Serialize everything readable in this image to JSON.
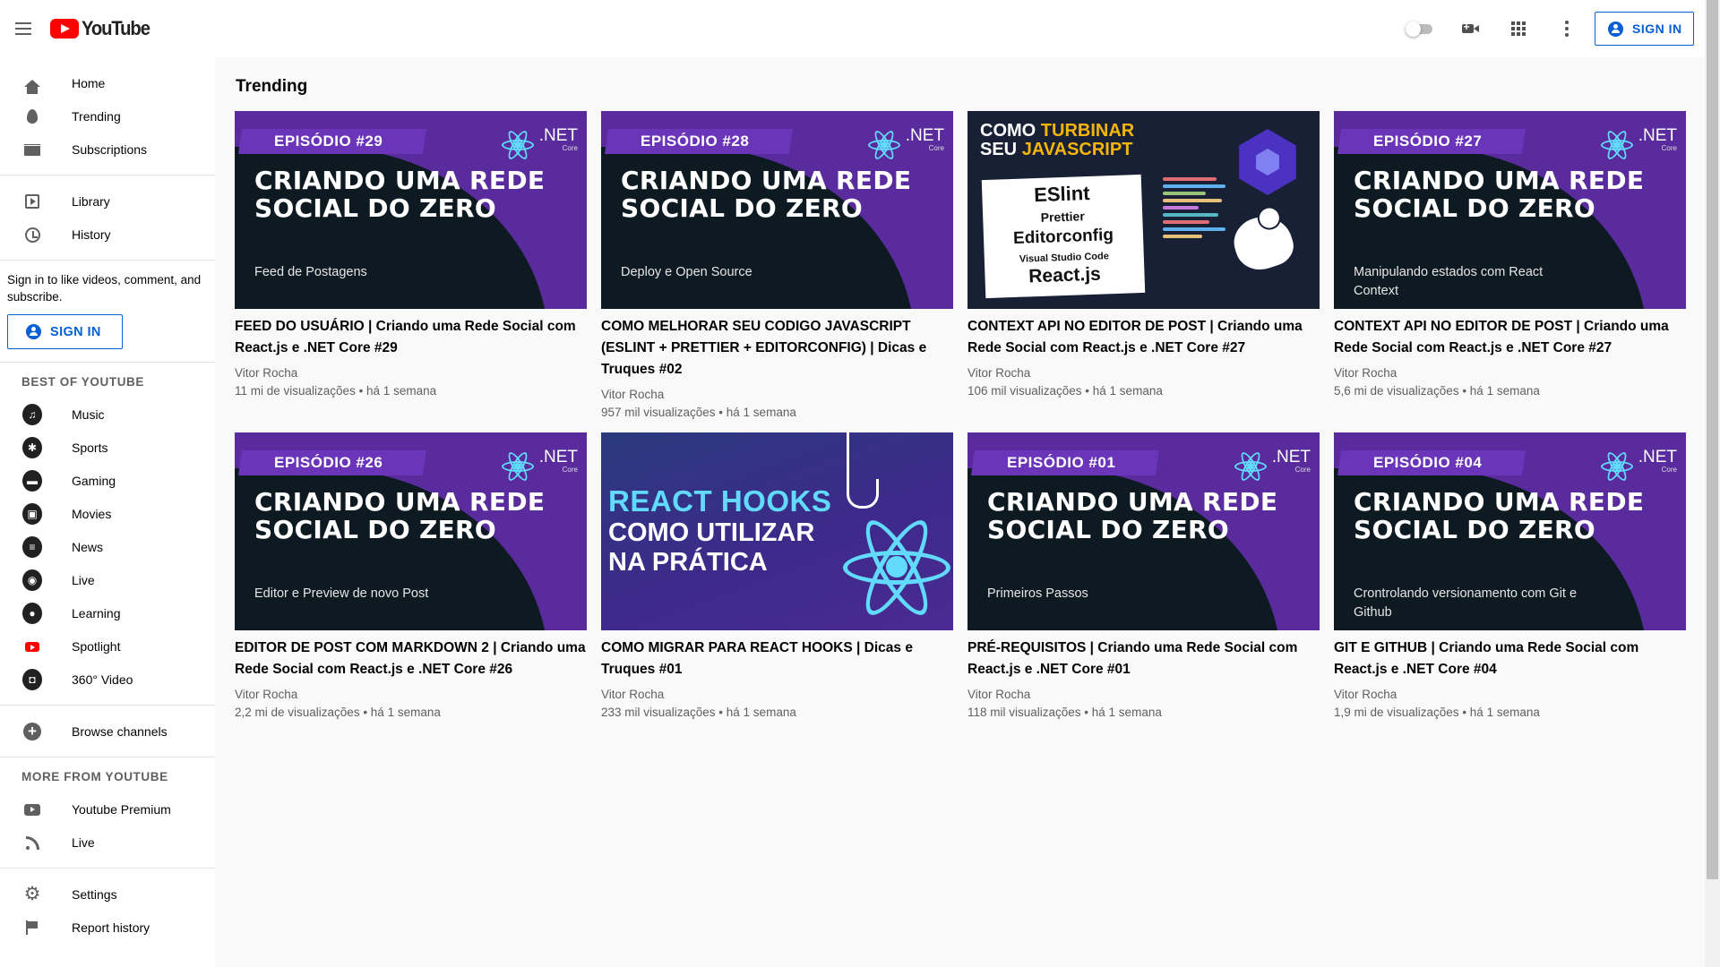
{
  "header": {
    "logo_text": "YouTube",
    "signin_label": "SIGN IN"
  },
  "sidebar": {
    "primary": [
      {
        "label": "Home",
        "icon": "home-icon"
      },
      {
        "label": "Trending",
        "icon": "trending-icon"
      },
      {
        "label": "Subscriptions",
        "icon": "subscriptions-icon"
      }
    ],
    "library": [
      {
        "label": "Library",
        "icon": "library-icon"
      },
      {
        "label": "History",
        "icon": "history-icon"
      }
    ],
    "signin_prompt": "Sign in to like videos, comment, and subscribe.",
    "signin_label": "SIGN IN",
    "best_title": "BEST OF YOUTUBE",
    "best": [
      {
        "label": "Music",
        "icon": "music-icon"
      },
      {
        "label": "Sports",
        "icon": "sports-icon"
      },
      {
        "label": "Gaming",
        "icon": "gaming-icon"
      },
      {
        "label": "Movies",
        "icon": "movies-icon"
      },
      {
        "label": "News",
        "icon": "news-icon"
      },
      {
        "label": "Live",
        "icon": "live-icon"
      },
      {
        "label": "Learning",
        "icon": "learning-icon"
      },
      {
        "label": "Spotlight",
        "icon": "spotlight-icon"
      },
      {
        "label": "360° Video",
        "icon": "360-video-icon"
      }
    ],
    "browse_label": "Browse channels",
    "more_title": "MORE FROM YOUTUBE",
    "more": [
      {
        "label": "Youtube Premium",
        "icon": "youtube-premium-icon"
      },
      {
        "label": "Live",
        "icon": "live-feed-icon"
      }
    ],
    "settings": [
      {
        "label": "Settings",
        "icon": "settings-icon"
      },
      {
        "label": "Report history",
        "icon": "report-flag-icon"
      }
    ]
  },
  "main": {
    "title": "Trending",
    "videos": [
      {
        "title": "FEED DO USUÁRIO | Criando uma Rede Social com React.js e .NET Core #29",
        "channel": "Vitor Rocha",
        "meta": "11 mi de visualizações • há 1 semana",
        "thumb": {
          "episode": "EPISÓDIO #29",
          "headline": "CRIANDO UMA REDE SOCIAL DO ZERO",
          "subtitle": "Feed de Postagens",
          "net": ".NET",
          "core": "Core"
        }
      },
      {
        "title": "COMO MELHORAR SEU CODIGO JAVASCRIPT (ESLINT + PRETTIER + EDITORCONFIG) | Dicas e Truques #02",
        "channel": "Vitor Rocha",
        "meta": "957 mil visualizações • há 1 semana",
        "thumb": {
          "episode": "EPISÓDIO #28",
          "headline": "CRIANDO UMA REDE SOCIAL DO ZERO",
          "subtitle": "Deploy e Open Source",
          "net": ".NET",
          "core": "Core"
        }
      },
      {
        "title": "CONTEXT API NO EDITOR DE POST | Criando uma Rede Social com React.js e .NET Core #27",
        "channel": "Vitor Rocha",
        "meta": "106 mil visualizações • há 1 semana",
        "thumb": {
          "title_a": "COMO ",
          "title_b": "TURBINAR",
          "title_c": "SEU ",
          "title_d": "JAVASCRIPT",
          "l1": "ESlint",
          "l2": "Prettier",
          "l3": "Editorconfig",
          "l4": "Visual Studio Code",
          "l5": "React.js"
        }
      },
      {
        "title": "CONTEXT API NO EDITOR DE POST | Criando uma Rede Social com React.js e .NET Core #27",
        "channel": "Vitor Rocha",
        "meta": "5,6 mi de visualizações • há 1 semana",
        "thumb": {
          "episode": "EPISÓDIO #27",
          "headline": "CRIANDO UMA REDE SOCIAL DO ZERO",
          "subtitle": "Manipulando estados com React Context",
          "net": ".NET",
          "core": "Core"
        }
      },
      {
        "title": "EDITOR DE POST COM MARKDOWN 2 | Criando uma Rede Social com React.js e .NET Core #26",
        "channel": "Vitor Rocha",
        "meta": "2,2 mi de visualizações • há 1 semana",
        "thumb": {
          "episode": "EPISÓDIO #26",
          "headline": "CRIANDO UMA REDE SOCIAL DO ZERO",
          "subtitle": "Editor e Preview de novo Post",
          "net": ".NET",
          "core": "Core"
        }
      },
      {
        "title": "COMO MIGRAR PARA REACT HOOKS | Dicas e Truques #01",
        "channel": "Vitor Rocha",
        "meta": "233 mil visualizações • há 1 semana",
        "thumb": {
          "line1": "REACT HOOKS",
          "line2": "COMO UTILIZAR NA PRÁTICA"
        }
      },
      {
        "title": "PRÉ-REQUISITOS | Criando uma Rede Social com React.js e .NET Core #01",
        "channel": "Vitor Rocha",
        "meta": "118 mil visualizações • há 1 semana",
        "thumb": {
          "episode": "EPISÓDIO #01",
          "headline": "CRIANDO UMA REDE SOCIAL DO ZERO",
          "subtitle": "Primeiros Passos",
          "net": ".NET",
          "core": "Core"
        }
      },
      {
        "title": "GIT E GITHUB | Criando uma Rede Social com React.js e .NET Core #04",
        "channel": "Vitor Rocha",
        "meta": "1,9 mi de visualizações • há 1 semana",
        "thumb": {
          "episode": "EPISÓDIO #04",
          "headline": "CRIANDO UMA REDE SOCIAL DO ZERO",
          "subtitle": "Crontrolando versionamento com Git e Github",
          "net": ".NET",
          "core": "Core"
        }
      }
    ]
  },
  "colors": {
    "brand_red": "#ff0000",
    "link_blue": "#065fd4",
    "episode_purple": "#5a2b9c",
    "react_cyan": "#61dafb"
  }
}
